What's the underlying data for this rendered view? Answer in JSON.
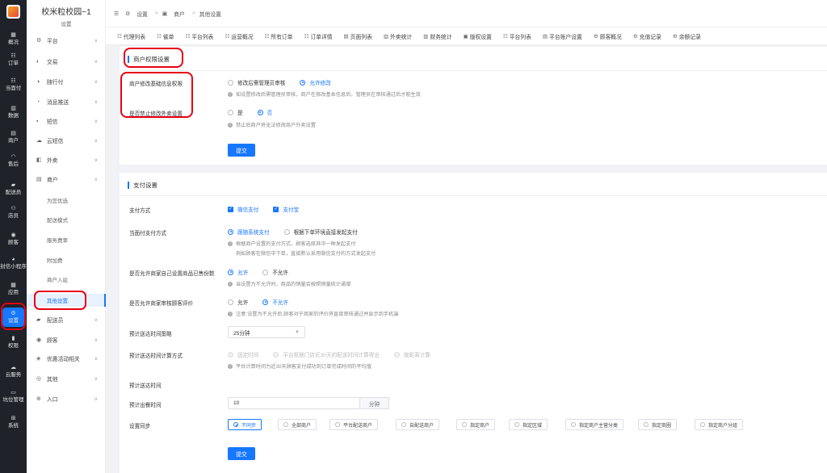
{
  "rail": {
    "items": [
      {
        "label": "概况",
        "icon": "dashboard-icon"
      },
      {
        "label": "订单",
        "icon": "list-icon"
      },
      {
        "label": "当面付",
        "icon": "list-icon"
      },
      {
        "label": "数据",
        "icon": "chart-icon"
      },
      {
        "label": "商户",
        "icon": "shop-icon"
      },
      {
        "label": "售后",
        "icon": "headset-icon"
      },
      {
        "label": "配送员",
        "icon": "truck-icon"
      },
      {
        "label": "店员",
        "icon": "user-icon"
      },
      {
        "label": "顾客",
        "icon": "customer-icon"
      },
      {
        "label": "封信小程序",
        "icon": "wechat-icon"
      },
      {
        "label": "应用",
        "icon": "grid-icon"
      },
      {
        "label": "设置",
        "icon": "settings-user-icon"
      },
      {
        "label": "权限",
        "icon": "lock-icon"
      },
      {
        "label": "云服务",
        "icon": "cloud-icon"
      },
      {
        "label": "坑位管理",
        "icon": "file-icon"
      },
      {
        "label": "系统",
        "icon": "windows-icon"
      }
    ]
  },
  "subnav": {
    "title": "校米粒校园~1",
    "subtitle": "设置",
    "items": [
      {
        "label": "平台",
        "icon": "gear-icon"
      },
      {
        "label": "交易",
        "icon": "trade-icon"
      },
      {
        "label": "随行付",
        "icon": "pay-icon"
      },
      {
        "label": "消息推送",
        "icon": "bell-icon"
      },
      {
        "label": "短信",
        "icon": "sms-icon"
      },
      {
        "label": "云短信",
        "icon": "cloud-sms-icon"
      },
      {
        "label": "外卖",
        "icon": "takeout-icon"
      },
      {
        "label": "商户",
        "icon": "shop-icon"
      }
    ],
    "children": [
      "为您优选",
      "配送模式",
      "服务费率",
      "附加费",
      "商户入驻",
      "其他设置"
    ],
    "after": [
      {
        "label": "配送员",
        "icon": "truck-icon"
      },
      {
        "label": "顾客",
        "icon": "customer-icon"
      },
      {
        "label": "优惠活动相关",
        "icon": "coupon-icon"
      },
      {
        "label": "其他",
        "icon": "other-icon"
      },
      {
        "label": "入口",
        "icon": "entry-icon"
      }
    ]
  },
  "topbar": {
    "breadcrumb": [
      "设置",
      "商户",
      "其他设置"
    ]
  },
  "tabs": [
    "代理列表",
    "催单",
    "平台列表",
    "运营概况",
    "所有订单",
    "订单详情",
    "页面列表",
    "外卖统计",
    "财务统计",
    "版权设置",
    "平台列表",
    "平台账户设置",
    "顾客概况",
    "充值记录",
    "余额记录"
  ],
  "panel1": {
    "title": "商户权限设置",
    "row1_label": "商户修改基础信息权限",
    "row1_opt_a": "修改后需管理员审核",
    "row1_opt_b": "允许修改",
    "row1_hint": "如设置修改后需管理员审核，商户在修改基本信息后，管理员在审核通过后才能生效",
    "row2_label": "是否禁止修改外卖设置",
    "row2_opt_a": "是",
    "row2_opt_b": "否",
    "row2_hint": "禁止后商户将无法修改商户外卖设置",
    "submit": "提交"
  },
  "panel2": {
    "title": "支付设置",
    "pay_label": "支付方式",
    "pay_wechat": "微信支付",
    "pay_alipay": "支付宝",
    "f2f_label": "当面付支付方式",
    "f2f_opt_a": "跟随系统支付",
    "f2f_opt_b": "根据下单环境直接发起支付",
    "f2f_hint1": "根据商户设置的支付方式，顾客选择其中一种发起支付",
    "f2f_hint2": "例如顾客在微信中下单，直接默认采用微信支付的方式发起支付",
    "sold_label": "是否允许商家自己设置商品已售份数",
    "sold_opt_a": "允许",
    "sold_opt_b": "不允许",
    "sold_hint": "当设置为不允许时，商品的销量会按照销量统计通增",
    "review_label": "是否允许商家审核顾客评价",
    "review_opt_a": "允许",
    "review_opt_b": "不允许",
    "review_hint": "注意:设置为不允许后,顾客对于商家的评价将直接审核通过并显示到手机端",
    "eta_label": "预计送达时间策略",
    "eta_value": "25分钟",
    "calc_label": "预计送达时间计算方式",
    "calc_opt_a": "固定时间",
    "calc_opt_b": "平台根据门店近30天的配送时间计算得出",
    "calc_opt_c": "按距离计算",
    "calc_hint": "平台计算时间为近30天顾客支付成功到订单完成时间的平均值",
    "eta2_label": "预计送达时间",
    "meal_label": "预计出餐时间",
    "meal_value": "10",
    "meal_unit": "分钟",
    "sync_label": "设置同步",
    "sync_options": [
      "不同步",
      "全部商户",
      "平台配送商户",
      "自配送商户",
      "指定商户",
      "指定区域",
      "指定商户主营分类",
      "指定商圈",
      "指定商户分组"
    ],
    "submit": "提交"
  },
  "colors": {
    "accent": "#1677ff",
    "highlight": "#e60012",
    "rail": "#1f2329"
  }
}
